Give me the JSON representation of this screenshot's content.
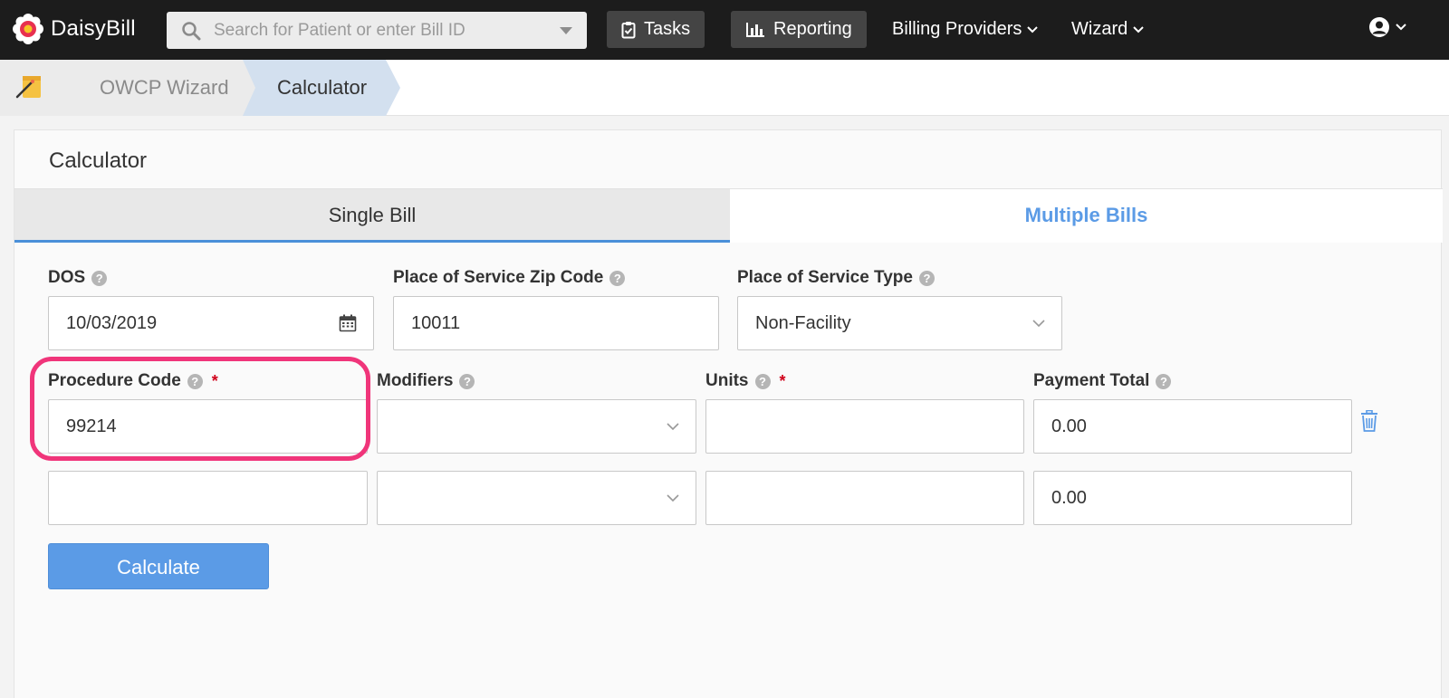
{
  "nav": {
    "brand": "DaisyBill",
    "search_placeholder": "Search for Patient or enter Bill ID",
    "tasks_label": "Tasks",
    "reporting_label": "Reporting",
    "billing_providers_label": "Billing Providers",
    "wizard_label": "Wizard"
  },
  "breadcrumb": {
    "items": [
      "OWCP Wizard",
      "Calculator"
    ]
  },
  "card": {
    "title": "Calculator",
    "tabs": [
      {
        "label": "Single Bill",
        "active": true
      },
      {
        "label": "Multiple Bills",
        "active": false
      }
    ]
  },
  "form": {
    "dos_label": "DOS",
    "dos_value": "10/03/2019",
    "zip_label": "Place of Service Zip Code",
    "zip_value": "10011",
    "pos_type_label": "Place of Service Type",
    "pos_type_value": "Non-Facility",
    "procedure_label": "Procedure Code",
    "modifiers_label": "Modifiers",
    "units_label": "Units",
    "payment_label": "Payment Total",
    "required_mark": "*",
    "help_mark": "?",
    "rows": [
      {
        "procedure": "99214",
        "modifiers": "",
        "units": "",
        "payment": "0.00"
      },
      {
        "procedure": "",
        "modifiers": "",
        "units": "",
        "payment": "0.00"
      }
    ],
    "calculate_label": "Calculate"
  },
  "colors": {
    "accent": "#5b9be6",
    "highlight": "#f0357a",
    "topbar": "#1c1c1c",
    "active_crumb": "#d3e0ef"
  }
}
